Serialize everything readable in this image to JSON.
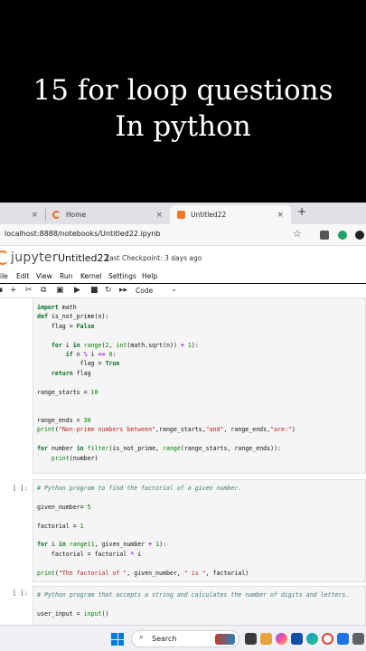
{
  "banner": {
    "line1": "15 for loop questions",
    "line2": "In python"
  },
  "browser": {
    "tabs": [
      {
        "label": ""
      },
      {
        "label": "Home"
      },
      {
        "label": "Untitled22"
      }
    ],
    "close_glyph": "×",
    "new_tab_glyph": "+",
    "url": "localhost:8888/notebooks/Untitled22.ipynb",
    "star_glyph": "☆"
  },
  "jupyter": {
    "logo_text": "jupyter",
    "notebook_name": "Untitled22",
    "checkpoint": "Last Checkpoint: 3 days ago",
    "menu": [
      "ile",
      "Edit",
      "View",
      "Run",
      "Kernel",
      "Settings",
      "Help"
    ],
    "toolbar": {
      "save": "▪",
      "add": "+",
      "cut": "✂",
      "copy": "⧉",
      "paste": "▣",
      "run": "▶",
      "stop": "■",
      "restart": "↻",
      "restart_run": "▸▸",
      "cell_type": "Code",
      "caret": "⌄"
    }
  },
  "cells": [
    {
      "prompt": "",
      "lines": [
        "import math",
        "def is_not_prime(n):",
        "    flag = False",
        "",
        "    for i in range(2, int(math.sqrt(n)) + 1):",
        "        if n % i == 0:",
        "            flag = True",
        "    return flag",
        "",
        "range_starts = 10",
        "",
        "",
        "range_ends = 30",
        "print(\"Non-prime numbers between\",range_starts,\"and\", range_ends,\"are:\")",
        "",
        "for number in filter(is_not_prime, range(range_starts, range_ends)):",
        "    print(number)"
      ]
    },
    {
      "prompt": "[ ]:",
      "lines": [
        "# Python program to find the factorial of a given number.",
        "",
        "given_number= 5",
        "",
        "factorial = 1",
        "",
        "for i in range(1, given_number + 1):",
        "    factorial = factorial * i",
        "",
        "print(\"The factorial of \", given_number, \" is \", factorial)"
      ]
    },
    {
      "prompt": "[ ]:",
      "lines": [
        "# Python program that accepts a string and calculates the number of digits and letters.",
        "",
        "user_input = input()"
      ]
    }
  ],
  "taskbar": {
    "search_label": "Search",
    "search_glyph": "⌕"
  },
  "colors": {
    "banner_bg": "#000000",
    "jupyter_orange": "#f37726",
    "keyword": "#007020",
    "string": "#ba2121",
    "comment": "#3d7b7b"
  }
}
